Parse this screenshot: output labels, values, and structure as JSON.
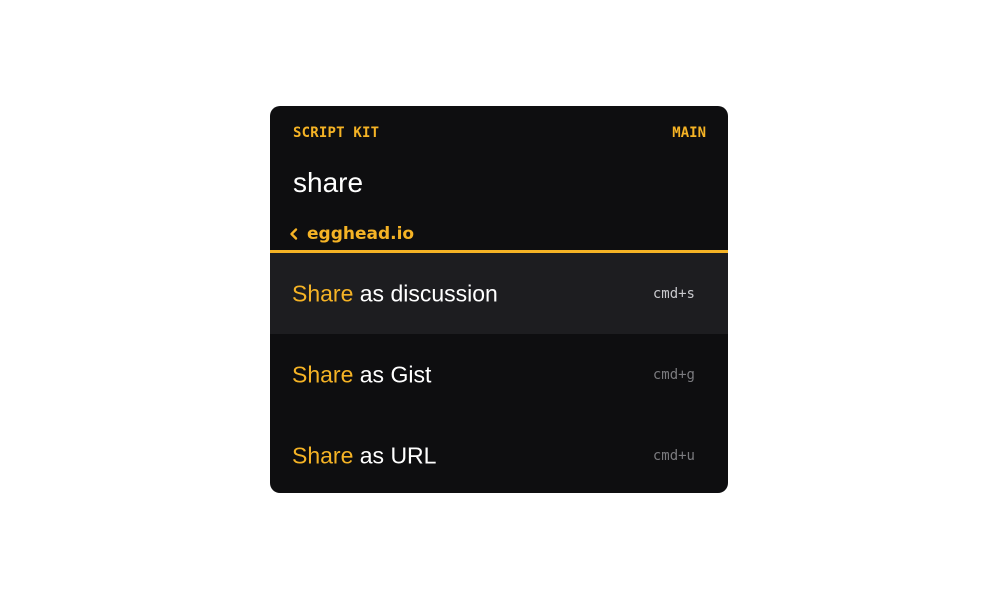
{
  "header": {
    "app_title": "SCRIPT KIT",
    "mode": "MAIN"
  },
  "search": {
    "value": "share"
  },
  "breadcrumb": {
    "label": "egghead.io",
    "icon": "chevron-left-icon"
  },
  "choices": [
    {
      "match": "Share",
      "rest": " as discussion",
      "shortcut": "cmd+s",
      "selected": true
    },
    {
      "match": "Share",
      "rest": " as Gist",
      "shortcut": "cmd+g",
      "selected": false
    },
    {
      "match": "Share",
      "rest": " as URL",
      "shortcut": "cmd+u",
      "selected": false
    }
  ],
  "colors": {
    "accent": "#f5b325",
    "panel_bg": "#0e0e10",
    "selected_bg": "#1d1d20",
    "text": "#ffffff",
    "muted": "#7a7a7e"
  }
}
